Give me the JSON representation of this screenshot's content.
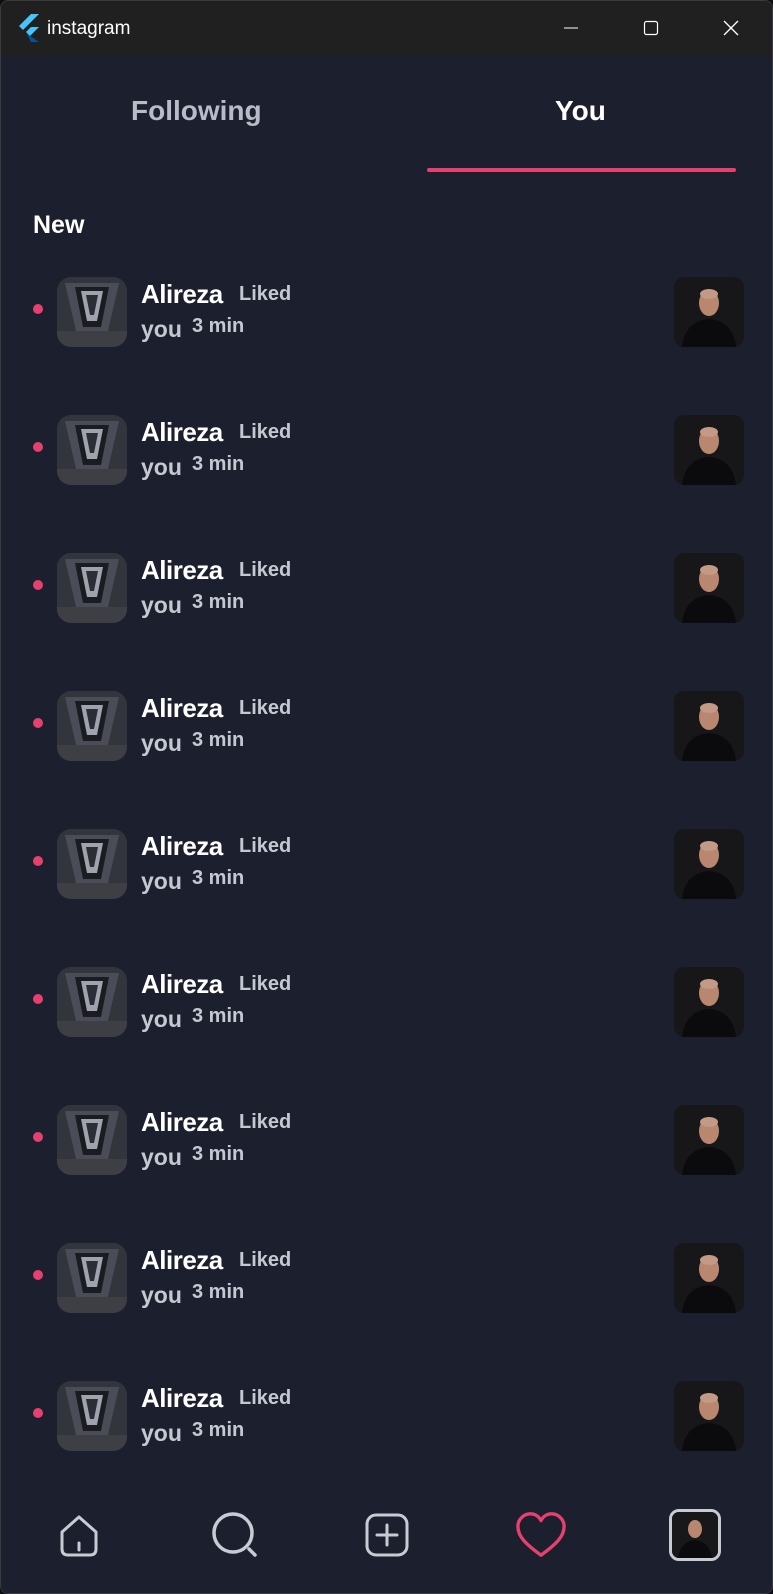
{
  "window": {
    "title": "instagram",
    "icons": {
      "app": "flutter-logo-icon",
      "minimize": "minimize-icon",
      "maximize": "maximize-icon",
      "close": "close-icon"
    }
  },
  "tabs": [
    {
      "label": "Following",
      "active": false
    },
    {
      "label": "You",
      "active": true
    }
  ],
  "section": {
    "title": "New"
  },
  "notifications": [
    {
      "name": "Alireza",
      "action": "Liked",
      "object": "you",
      "time": "3 min",
      "unread": true
    },
    {
      "name": "Alireza",
      "action": "Liked",
      "object": "you",
      "time": "3 min",
      "unread": true
    },
    {
      "name": "Alireza",
      "action": "Liked",
      "object": "you",
      "time": "3 min",
      "unread": true
    },
    {
      "name": "Alireza",
      "action": "Liked",
      "object": "you",
      "time": "3 min",
      "unread": true
    },
    {
      "name": "Alireza",
      "action": "Liked",
      "object": "you",
      "time": "3 min",
      "unread": true
    },
    {
      "name": "Alireza",
      "action": "Liked",
      "object": "you",
      "time": "3 min",
      "unread": true
    },
    {
      "name": "Alireza",
      "action": "Liked",
      "object": "you",
      "time": "3 min",
      "unread": true
    },
    {
      "name": "Alireza",
      "action": "Liked",
      "object": "you",
      "time": "3 min",
      "unread": true
    },
    {
      "name": "Alireza",
      "action": "Liked",
      "object": "you",
      "time": "3 min",
      "unread": true
    }
  ],
  "bottom_nav": {
    "items": [
      "home-icon",
      "search-icon",
      "add-post-icon",
      "heart-icon",
      "profile-avatar"
    ],
    "active": "heart-icon"
  },
  "colors": {
    "background": "#1c1f2e",
    "accent": "#e5406e",
    "titlebar": "#202020",
    "text_primary": "#ffffff",
    "text_secondary": "#c6c8d1"
  }
}
